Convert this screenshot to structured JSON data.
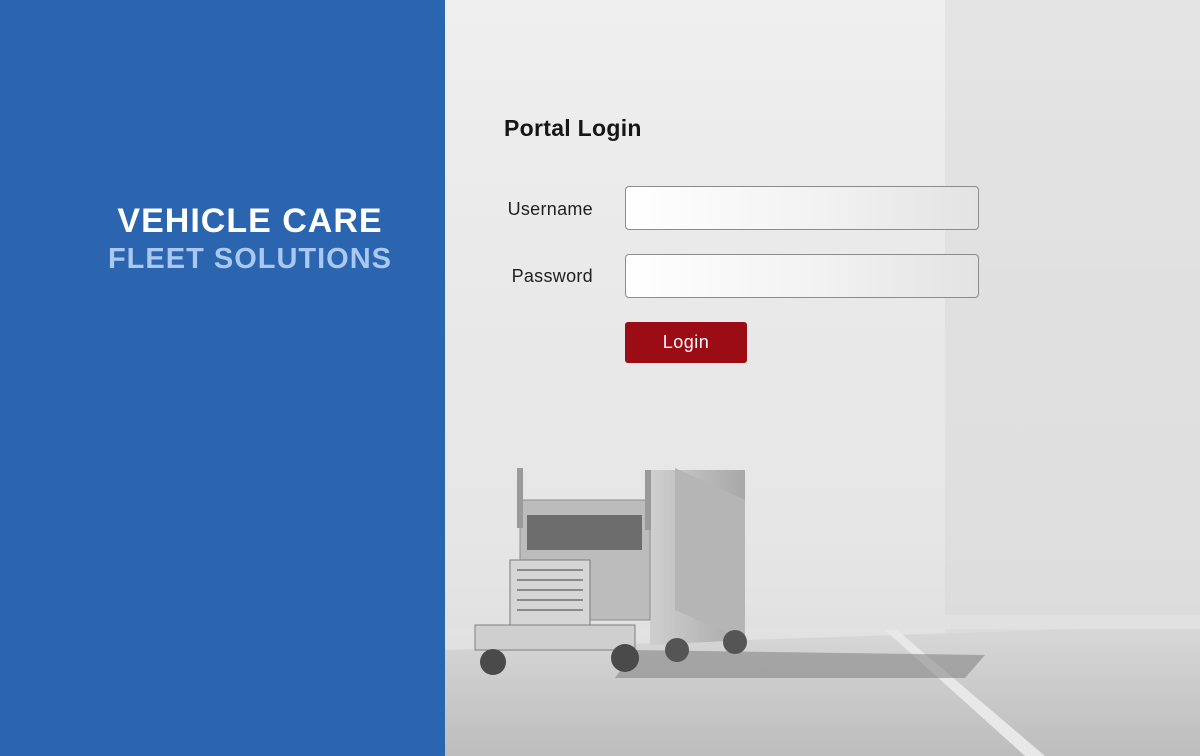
{
  "brand": {
    "title": "VEHICLE CARE",
    "subtitle": "FLEET SOLUTIONS"
  },
  "login": {
    "heading": "Portal Login",
    "username_label": "Username",
    "password_label": "Password",
    "username_value": "",
    "password_value": "",
    "button_label": "Login"
  },
  "colors": {
    "brand_blue": "#2b65b0",
    "subtitle_blue": "#a9c8f2",
    "button_red": "#9c0c14"
  },
  "background": {
    "image_subject": "semi-truck-on-highway"
  }
}
